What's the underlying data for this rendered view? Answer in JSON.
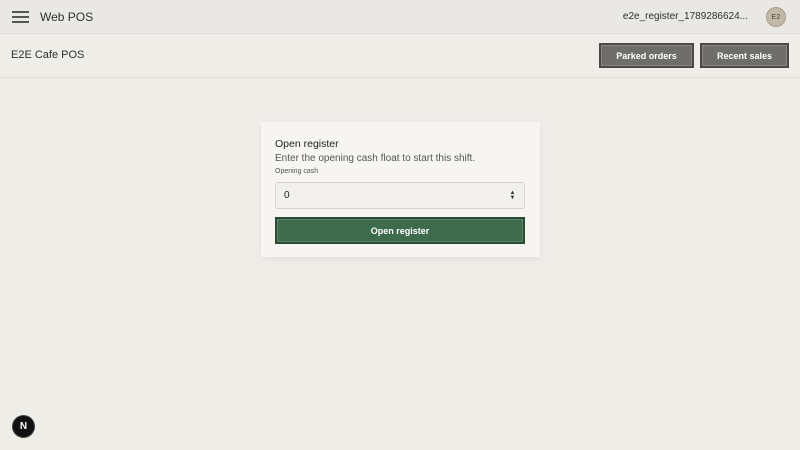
{
  "topbar": {
    "menu_icon": "hamburger-menu-icon",
    "app_title": "Web POS",
    "user_label": "e2e_register_1789286624...",
    "avatar_initials": "E2"
  },
  "subheader": {
    "store_name": "E2E Cafe POS",
    "parked_orders_label": "Parked orders",
    "recent_sales_label": "Recent sales"
  },
  "register_card": {
    "title": "Open register",
    "description": "Enter the opening cash float to start this shift.",
    "field_label": "Opening cash",
    "field_value": "0",
    "submit_label": "Open register"
  },
  "dev_badge": {
    "letter": "N",
    "icon": "nextjs-icon"
  },
  "colors": {
    "background": "#efede8",
    "primary_button": "#3d6b4c",
    "secondary_button": "#6e6d69"
  }
}
